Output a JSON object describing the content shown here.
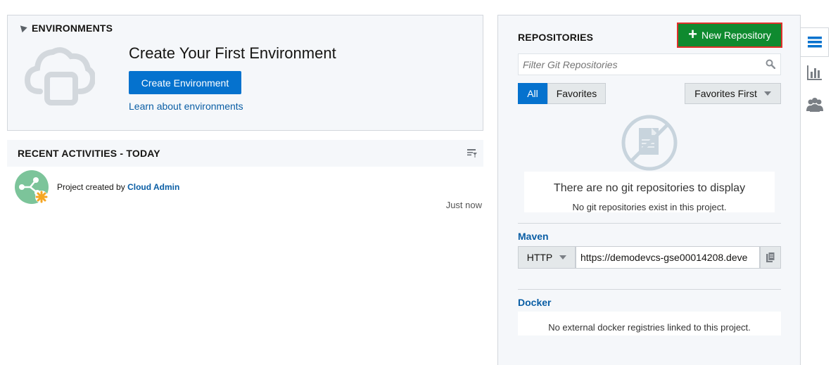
{
  "environments": {
    "header": "ENVIRONMENTS",
    "title": "Create Your First Environment",
    "create_button": "Create Environment",
    "learn_link": "Learn about environments"
  },
  "recent_activities": {
    "header": "RECENT ACTIVITIES - TODAY",
    "items": [
      {
        "text": "Project created by",
        "user": "Cloud Admin",
        "time": "Just now"
      }
    ]
  },
  "repositories": {
    "header": "REPOSITORIES",
    "new_button": "New Repository",
    "filter_placeholder": "Filter Git Repositories",
    "tabs": [
      {
        "label": "All",
        "selected": true
      },
      {
        "label": "Favorites",
        "selected": false
      }
    ],
    "sort_value": "Favorites First",
    "empty_title": "There are no git repositories to display",
    "empty_subtitle": "No git repositories exist in this project."
  },
  "maven": {
    "label": "Maven",
    "protocol": "HTTP",
    "url": "https://demodevcs-gse00014208.deve"
  },
  "docker": {
    "label": "Docker",
    "message": "No external docker registries linked to this project."
  },
  "rail": {
    "items": [
      "list-icon",
      "bar-chart-icon",
      "team-icon"
    ]
  },
  "colors": {
    "primary_blue": "#0572ce",
    "link_blue": "#0a5ea5",
    "new_repo_green": "#0f8a2f",
    "highlight_red": "#e0302b",
    "panel_bg": "#f5f7fa"
  }
}
